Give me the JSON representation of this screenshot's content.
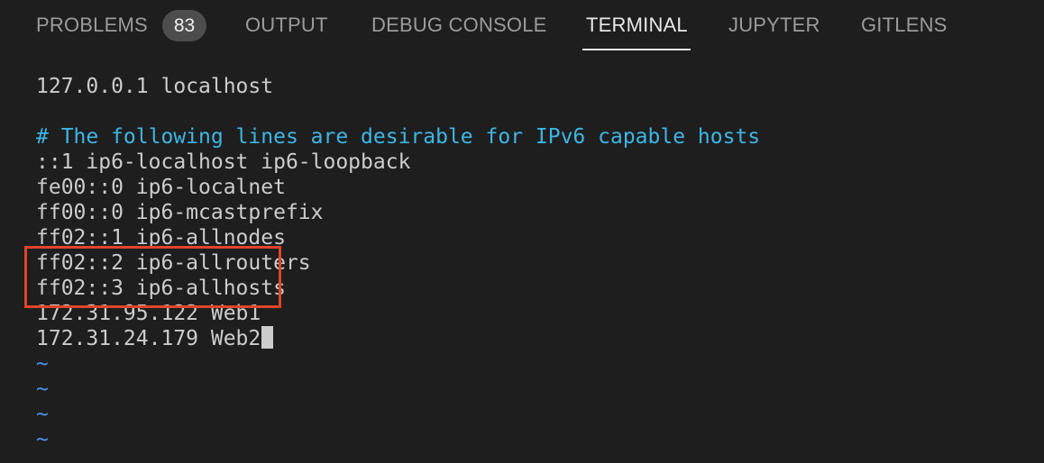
{
  "tabs": {
    "problems": "PROBLEMS",
    "problems_count": "83",
    "output": "OUTPUT",
    "debug_console": "DEBUG CONSOLE",
    "terminal": "TERMINAL",
    "jupyter": "JUPYTER",
    "gitlens": "GITLENS",
    "active": "TERMINAL"
  },
  "terminal": {
    "lines": [
      "127.0.0.1 localhost",
      "",
      "# The following lines are desirable for IPv6 capable hosts",
      "::1 ip6-localhost ip6-loopback",
      "fe00::0 ip6-localnet",
      "ff00::0 ip6-mcastprefix",
      "ff02::1 ip6-allnodes",
      "ff02::2 ip6-allrouters",
      "ff02::3 ip6-allhosts",
      "172.31.95.122 Web1",
      "172.31.24.179 Web2",
      "~",
      "~",
      "~",
      "~"
    ]
  },
  "colors": {
    "background": "#1e1e1e",
    "text": "#cccccc",
    "comment": "#3cb6e6",
    "tilde": "#4b8fe8",
    "highlight_border": "#e0442a"
  }
}
